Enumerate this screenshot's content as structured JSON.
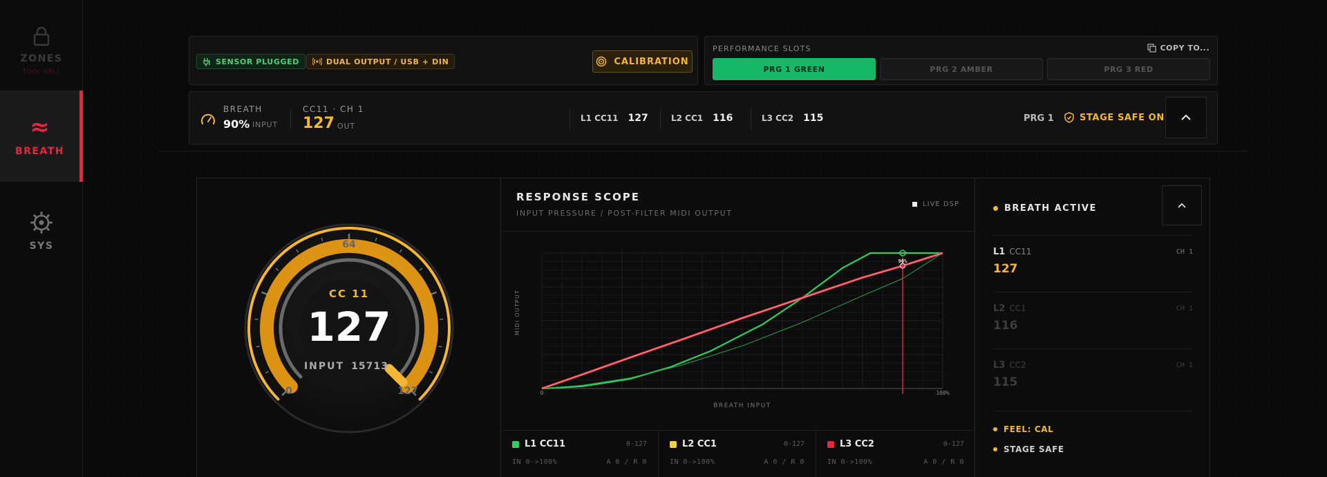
{
  "sidebar": {
    "items": [
      {
        "id": "zones",
        "label": "ZONES",
        "sublabel": "TOOL ONLY",
        "icon": "lock-icon"
      },
      {
        "id": "breath",
        "label": "BREATH",
        "icon": "wave-icon",
        "active": true
      },
      {
        "id": "sys",
        "label": "SYS",
        "icon": "gear-icon"
      }
    ]
  },
  "status": {
    "sensor": "SENSOR PLUGGED",
    "output": "DUAL OUTPUT / USB + DIN",
    "calibration": "CALIBRATION"
  },
  "slots": {
    "title": "PERFORMANCE SLOTS",
    "copy": "COPY TO...",
    "items": [
      "PRG 1 GREEN",
      "PRG 2 AMBER",
      "PRG 3 RED"
    ]
  },
  "metrics": {
    "breath_label": "BREATH",
    "breath_value": "90%",
    "breath_unit": "INPUT",
    "cc_label": "CC11 · CH 1",
    "cc_value": "127",
    "cc_unit": "OUT",
    "lanes": [
      {
        "label": "L1 CC11",
        "value": "127"
      },
      {
        "label": "L2 CC1",
        "value": "116"
      },
      {
        "label": "L3 CC2",
        "value": "115"
      }
    ],
    "program": "PRG 1",
    "stage_safe": "STAGE SAFE ON"
  },
  "gauge": {
    "cc_label": "CC 11",
    "value": "127",
    "input_label": "INPUT",
    "input_value": "15713",
    "min_label": "0",
    "mid_label": "64",
    "max_label": "127",
    "fraction": 1.0
  },
  "scope": {
    "title": "RESPONSE SCOPE",
    "subtitle": "INPUT PRESSURE / POST-FILTER MIDI OUTPUT",
    "live": "LIVE DSP",
    "xlabel": "BREATH INPUT",
    "ylabel": "MIDI OUTPUT",
    "x_min": "0",
    "x_max": "100%",
    "cursor_label": "90%"
  },
  "chart_data": {
    "type": "line",
    "xlabel": "BREATH INPUT",
    "ylabel": "MIDI OUTPUT",
    "xlim": [
      0,
      100
    ],
    "ylim": [
      0,
      127
    ],
    "cursor_x": 90,
    "series": [
      {
        "color": "#2fcf62",
        "width": 2.2,
        "x": [
          0,
          10,
          22,
          32,
          42,
          55,
          65,
          75,
          82,
          90,
          100
        ],
        "y": [
          0,
          2,
          9,
          20,
          35,
          60,
          85,
          113,
          127,
          127,
          127
        ]
      },
      {
        "color": "#2aa651",
        "width": 1,
        "x": [
          0,
          10,
          22,
          35,
          50,
          65,
          80,
          90,
          100
        ],
        "y": [
          0,
          3,
          10,
          22,
          40,
          62,
          87,
          103,
          127
        ]
      },
      {
        "color": "#e63b48",
        "width": 3.2,
        "x": [
          0,
          10,
          22,
          35,
          50,
          65,
          80,
          90,
          100
        ],
        "y": [
          0,
          13,
          29,
          46,
          66,
          85,
          104,
          115,
          127
        ]
      }
    ]
  },
  "scope_lanes": [
    {
      "name": "L1 CC11",
      "range": "0-127",
      "io": "IN 0->100%",
      "ar": "A 0 / R 0",
      "color": "#2fcf62"
    },
    {
      "name": "L2 CC1",
      "range": "0-127",
      "io": "IN 0->100%",
      "ar": "A 0 / R 0",
      "color": "#f2d23e"
    },
    {
      "name": "L3 CC2",
      "range": "0-127",
      "io": "IN 0->100%",
      "ar": "A 0 / R 0",
      "color": "#e8253b"
    }
  ],
  "side": {
    "heading": "BREATH ACTIVE",
    "rows": [
      {
        "lane": "L1",
        "cc": "CC11",
        "ch": "CH 1",
        "value": "127"
      },
      {
        "lane": "L2",
        "cc": "CC1",
        "ch": "CH 1",
        "value": "116"
      },
      {
        "lane": "L3",
        "cc": "CC2",
        "ch": "CH 1",
        "value": "115"
      }
    ],
    "flags": [
      "FEEL: CAL",
      "STAGE SAFE"
    ]
  },
  "colors": {
    "accent": "#f5b634",
    "green": "#17b86a",
    "red": "#e8253b"
  }
}
